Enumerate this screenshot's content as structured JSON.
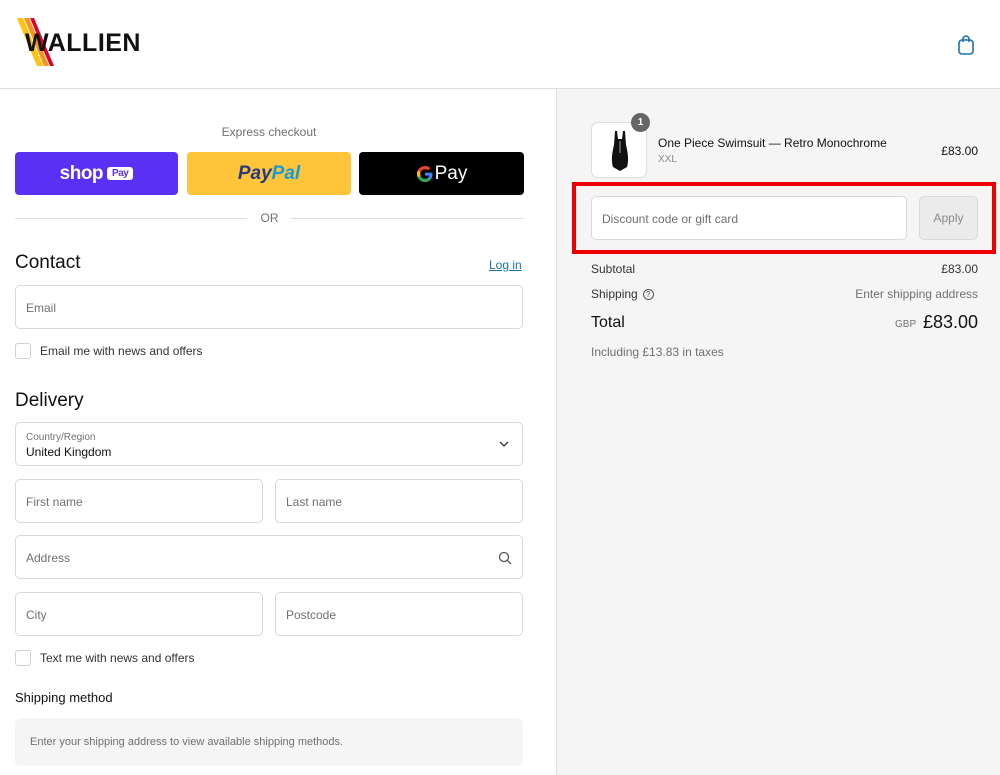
{
  "brand": {
    "name": "WALLIEN",
    "stripe_colors": [
      "#ffc20e",
      "#f7941d",
      "#e4002b"
    ]
  },
  "express": {
    "label": "Express checkout",
    "shop_text": "shop",
    "shop_pay_badge": "Pay",
    "paypal_part1": "Pay",
    "paypal_part2": "Pal",
    "gpay_g": "G",
    "gpay_text": "Pay",
    "or_text": "OR"
  },
  "contact": {
    "title": "Contact",
    "login_label": "Log in",
    "email_placeholder": "Email",
    "news_label": "Email me with news and offers"
  },
  "delivery": {
    "title": "Delivery",
    "country_label": "Country/Region",
    "country_value": "United Kingdom",
    "first_name_placeholder": "First name",
    "last_name_placeholder": "Last name",
    "address_placeholder": "Address",
    "city_placeholder": "City",
    "postcode_placeholder": "Postcode",
    "sms_label": "Text me with news and offers"
  },
  "shipping": {
    "title": "Shipping method",
    "placeholder_text": "Enter your shipping address to view available shipping methods."
  },
  "order": {
    "product_name": "One Piece Swimsuit — Retro Monochrome",
    "product_variant": "XXL",
    "product_price": "£83.00",
    "quantity": "1",
    "discount_placeholder": "Discount code or gift card",
    "apply_label": "Apply",
    "subtotal_label": "Subtotal",
    "subtotal_value": "£83.00",
    "shipping_label": "Shipping",
    "shipping_value": "Enter shipping address",
    "total_label": "Total",
    "currency": "GBP",
    "total_value": "£83.00",
    "tax_note": "Including £13.83 in taxes"
  },
  "colors": {
    "shop_pay": "#5a31f4",
    "paypal": "#ffc439",
    "gpay": "#000000",
    "link": "#1773b0",
    "highlight": "#ee0000"
  }
}
